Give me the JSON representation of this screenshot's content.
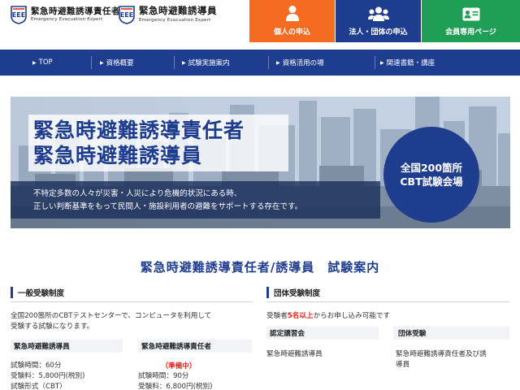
{
  "header": {
    "logo1": {
      "jp": "緊急時避難誘導責任者",
      "en": "Emergency Evacuation Expert",
      "mark": "EEE"
    },
    "logo2": {
      "jp": "緊急時避難誘導員",
      "en": "Emergency Evacuation Expert",
      "mark": "EEE"
    },
    "buttons": [
      {
        "label": "個人の申込",
        "icon": "person-icon",
        "color": "#f36c21"
      },
      {
        "label": "法人・団体の申込",
        "icon": "group-icon",
        "color": "#1f3d8f"
      },
      {
        "label": "会員専用ページ",
        "icon": "member-card-icon",
        "color": "#1e9e56"
      }
    ]
  },
  "nav": {
    "items": [
      "TOP",
      "資格概要",
      "試験実施案内",
      "資格活用の場",
      "関連書籍・講座"
    ]
  },
  "hero": {
    "title_line1": "緊急時避難誘導責任者",
    "title_line2": "緊急時避難誘導員",
    "sub_line1": "不特定多数の人々が災害・人災により危機的状況にある時、",
    "sub_line2": "正しい判断基準をもって民間人・施設利用者の避難をサポートする存在です。",
    "circle_line1": "全国200箇所",
    "circle_line2": "CBT試験会場"
  },
  "section": {
    "title": "緊急時避難誘導責任者/誘導員　試験案内"
  },
  "general": {
    "heading": "一般受験制度",
    "desc_line1": "全国200箇所のCBTテストセンターで、コンピュータを利用して",
    "desc_line2": "受験する試験になります。",
    "col1_title": "緊急時避難誘導員",
    "col1_time": "試験時間：60分",
    "col1_fee": "受験料：5,800円(税別)",
    "col1_cut": "試験形式（CBT）",
    "col2_title": "緊急時避難誘導責任者",
    "col2_status": "（準備中）",
    "col2_time": "試験時間：90分",
    "col2_cut": "受験料：6,800円(税別)"
  },
  "group": {
    "heading": "団体受験制度",
    "desc_prefix": "受験者",
    "desc_highlight": "5名以上",
    "desc_suffix": "からお申し込み可能です",
    "col1_title": "認定講習会",
    "col1_text": "緊急時避難誘導員",
    "col2_title": "団体受験",
    "col2_text_line1": "緊急時避難誘導責任者及び誘",
    "col2_text_line2": "導員"
  },
  "colors": {
    "brand_blue": "#1f3d8f",
    "orange": "#f36c21",
    "green": "#1e9e56",
    "accent_red": "#e2231a"
  }
}
